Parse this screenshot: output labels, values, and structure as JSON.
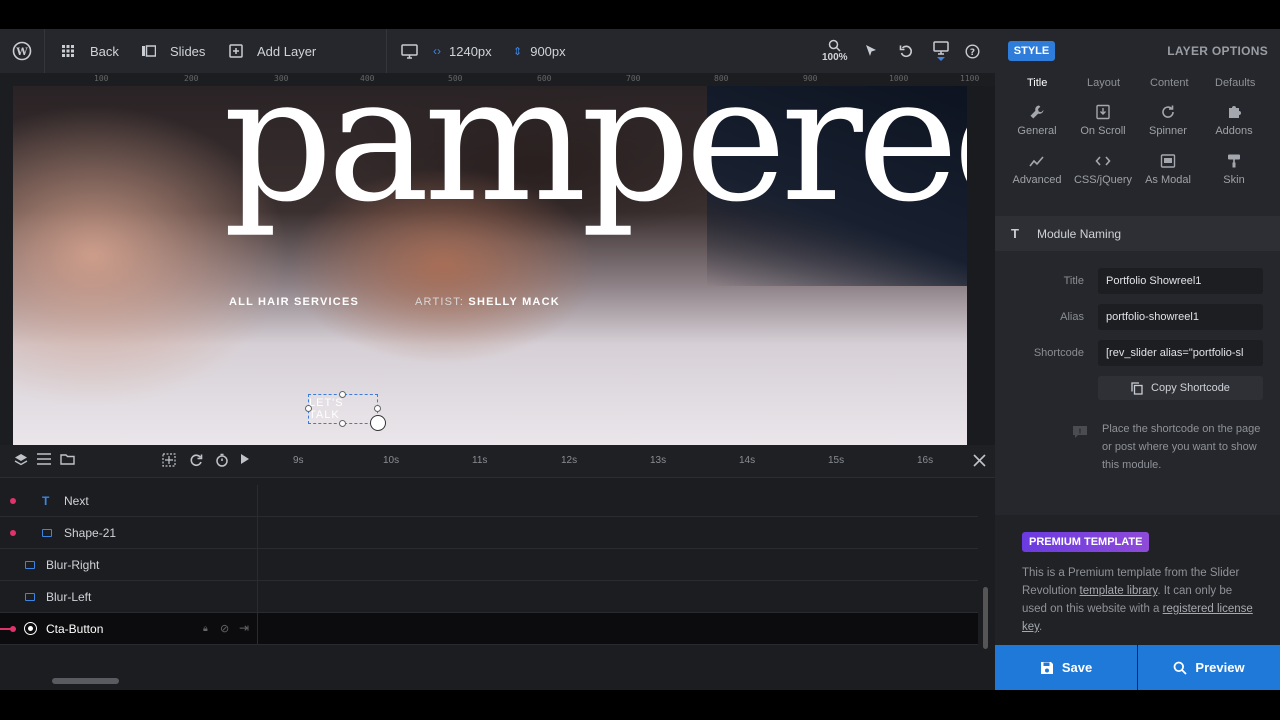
{
  "toolbar": {
    "back_label": "Back",
    "slides_label": "Slides",
    "add_layer_label": "Add Layer",
    "width_value": "1240px",
    "height_value": "900px",
    "zoom_value": "100%"
  },
  "ruler": {
    "top_ticks": [
      "100",
      "200",
      "300",
      "400",
      "500",
      "600",
      "700",
      "800",
      "900",
      "1000",
      "1100"
    ]
  },
  "canvas": {
    "headline": "pampered",
    "services": "ALL HAIR SERVICES",
    "artist_label": "ARTIST:",
    "artist_name": "SHELLY MACK",
    "cta_text": "LET'S TALK"
  },
  "timeline": {
    "times": [
      "9s",
      "10s",
      "11s",
      "12s",
      "13s",
      "14s",
      "15s",
      "16s"
    ],
    "layers": [
      {
        "name": "Next"
      },
      {
        "name": "Shape-21"
      },
      {
        "name": "Blur-Right"
      },
      {
        "name": "Blur-Left"
      },
      {
        "name": "Cta-Button"
      }
    ]
  },
  "panel": {
    "style_label": "STYLE",
    "layer_options_label": "LAYER OPTIONS",
    "tabs": [
      "Title",
      "Layout",
      "Content",
      "Defaults"
    ],
    "grid": [
      "General",
      "On Scroll",
      "Spinner",
      "Addons",
      "Advanced",
      "CSS/jQuery",
      "As Modal",
      "Skin"
    ],
    "section_title": "Module Naming",
    "title_label": "Title",
    "title_value": "Portfolio Showreel1",
    "alias_label": "Alias",
    "alias_value": "portfolio-showreel1",
    "shortcode_label": "Shortcode",
    "shortcode_value": "[rev_slider alias=\"portfolio-sl",
    "copy_label": "Copy Shortcode",
    "hint": "Place the shortcode on the page or post where you want to show this module.",
    "premium_badge": "PREMIUM TEMPLATE",
    "premium_text_1": "This is a Premium template from the Slider Revolution ",
    "premium_link_1": "template library",
    "premium_text_2": ". It can only be used on this website with a ",
    "premium_link_2": "registered license key",
    "premium_text_3": ".",
    "save_label": "Save",
    "preview_label": "Preview"
  },
  "colors": {
    "accent": "#1f79d8",
    "style_button": "#2f7ddb",
    "layer_dot": "#e0336b",
    "premium": "#7b44de"
  }
}
